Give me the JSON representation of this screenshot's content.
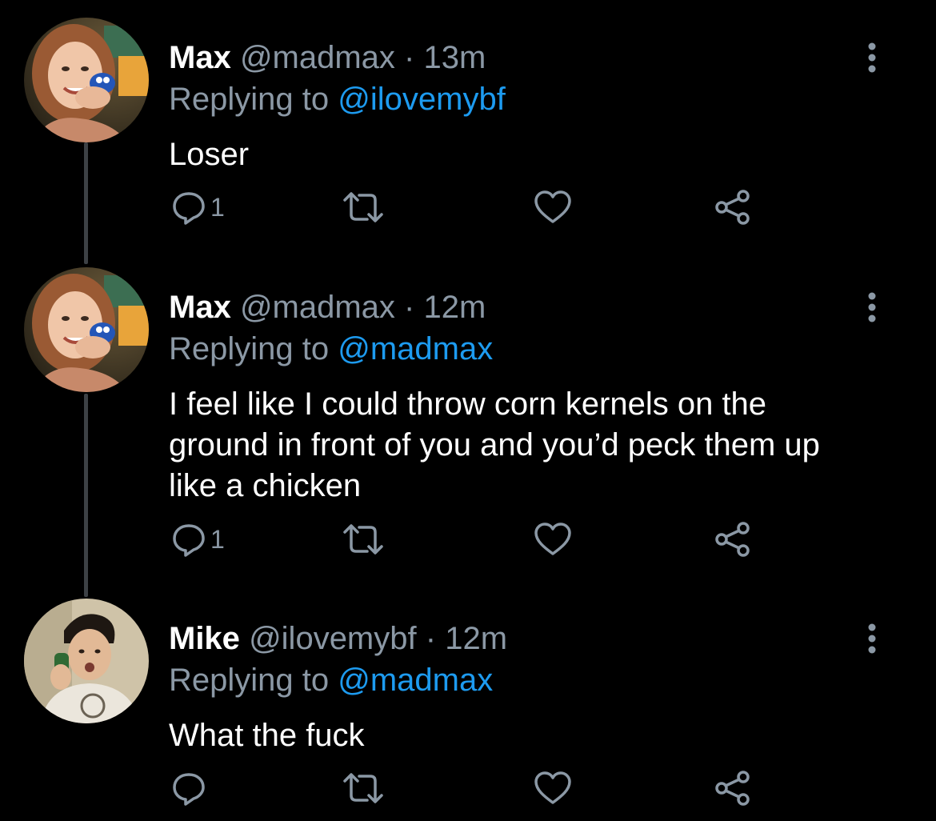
{
  "colors": {
    "background": "#000000",
    "text": "#ffffff",
    "secondary": "#8b98a5",
    "accent": "#1d9bf0",
    "thread_line": "#3d4145"
  },
  "tweets": [
    {
      "name": "Max",
      "handle": "@madmax",
      "separator": "·",
      "time": "13m",
      "replying_label": "Replying to",
      "replying_handle": "@ilovemybf",
      "text": "Loser",
      "reply_count": "1",
      "icons": [
        "reply-icon",
        "retweet-icon",
        "like-icon",
        "share-icon",
        "more-icon"
      ]
    },
    {
      "name": "Max",
      "handle": "@madmax",
      "separator": "·",
      "time": "12m",
      "replying_label": "Replying to",
      "replying_handle": "@madmax",
      "text": "I feel like I could throw corn kernels on the ground in front of you and you’d peck them up like a chicken",
      "reply_count": "1",
      "icons": [
        "reply-icon",
        "retweet-icon",
        "like-icon",
        "share-icon",
        "more-icon"
      ]
    },
    {
      "name": "Mike",
      "handle": "@ilovemybf",
      "separator": "·",
      "time": "12m",
      "replying_label": "Replying to",
      "replying_handle": "@madmax",
      "text": "What the fuck",
      "reply_count": "",
      "icons": [
        "reply-icon",
        "retweet-icon",
        "like-icon",
        "share-icon",
        "more-icon"
      ]
    }
  ]
}
